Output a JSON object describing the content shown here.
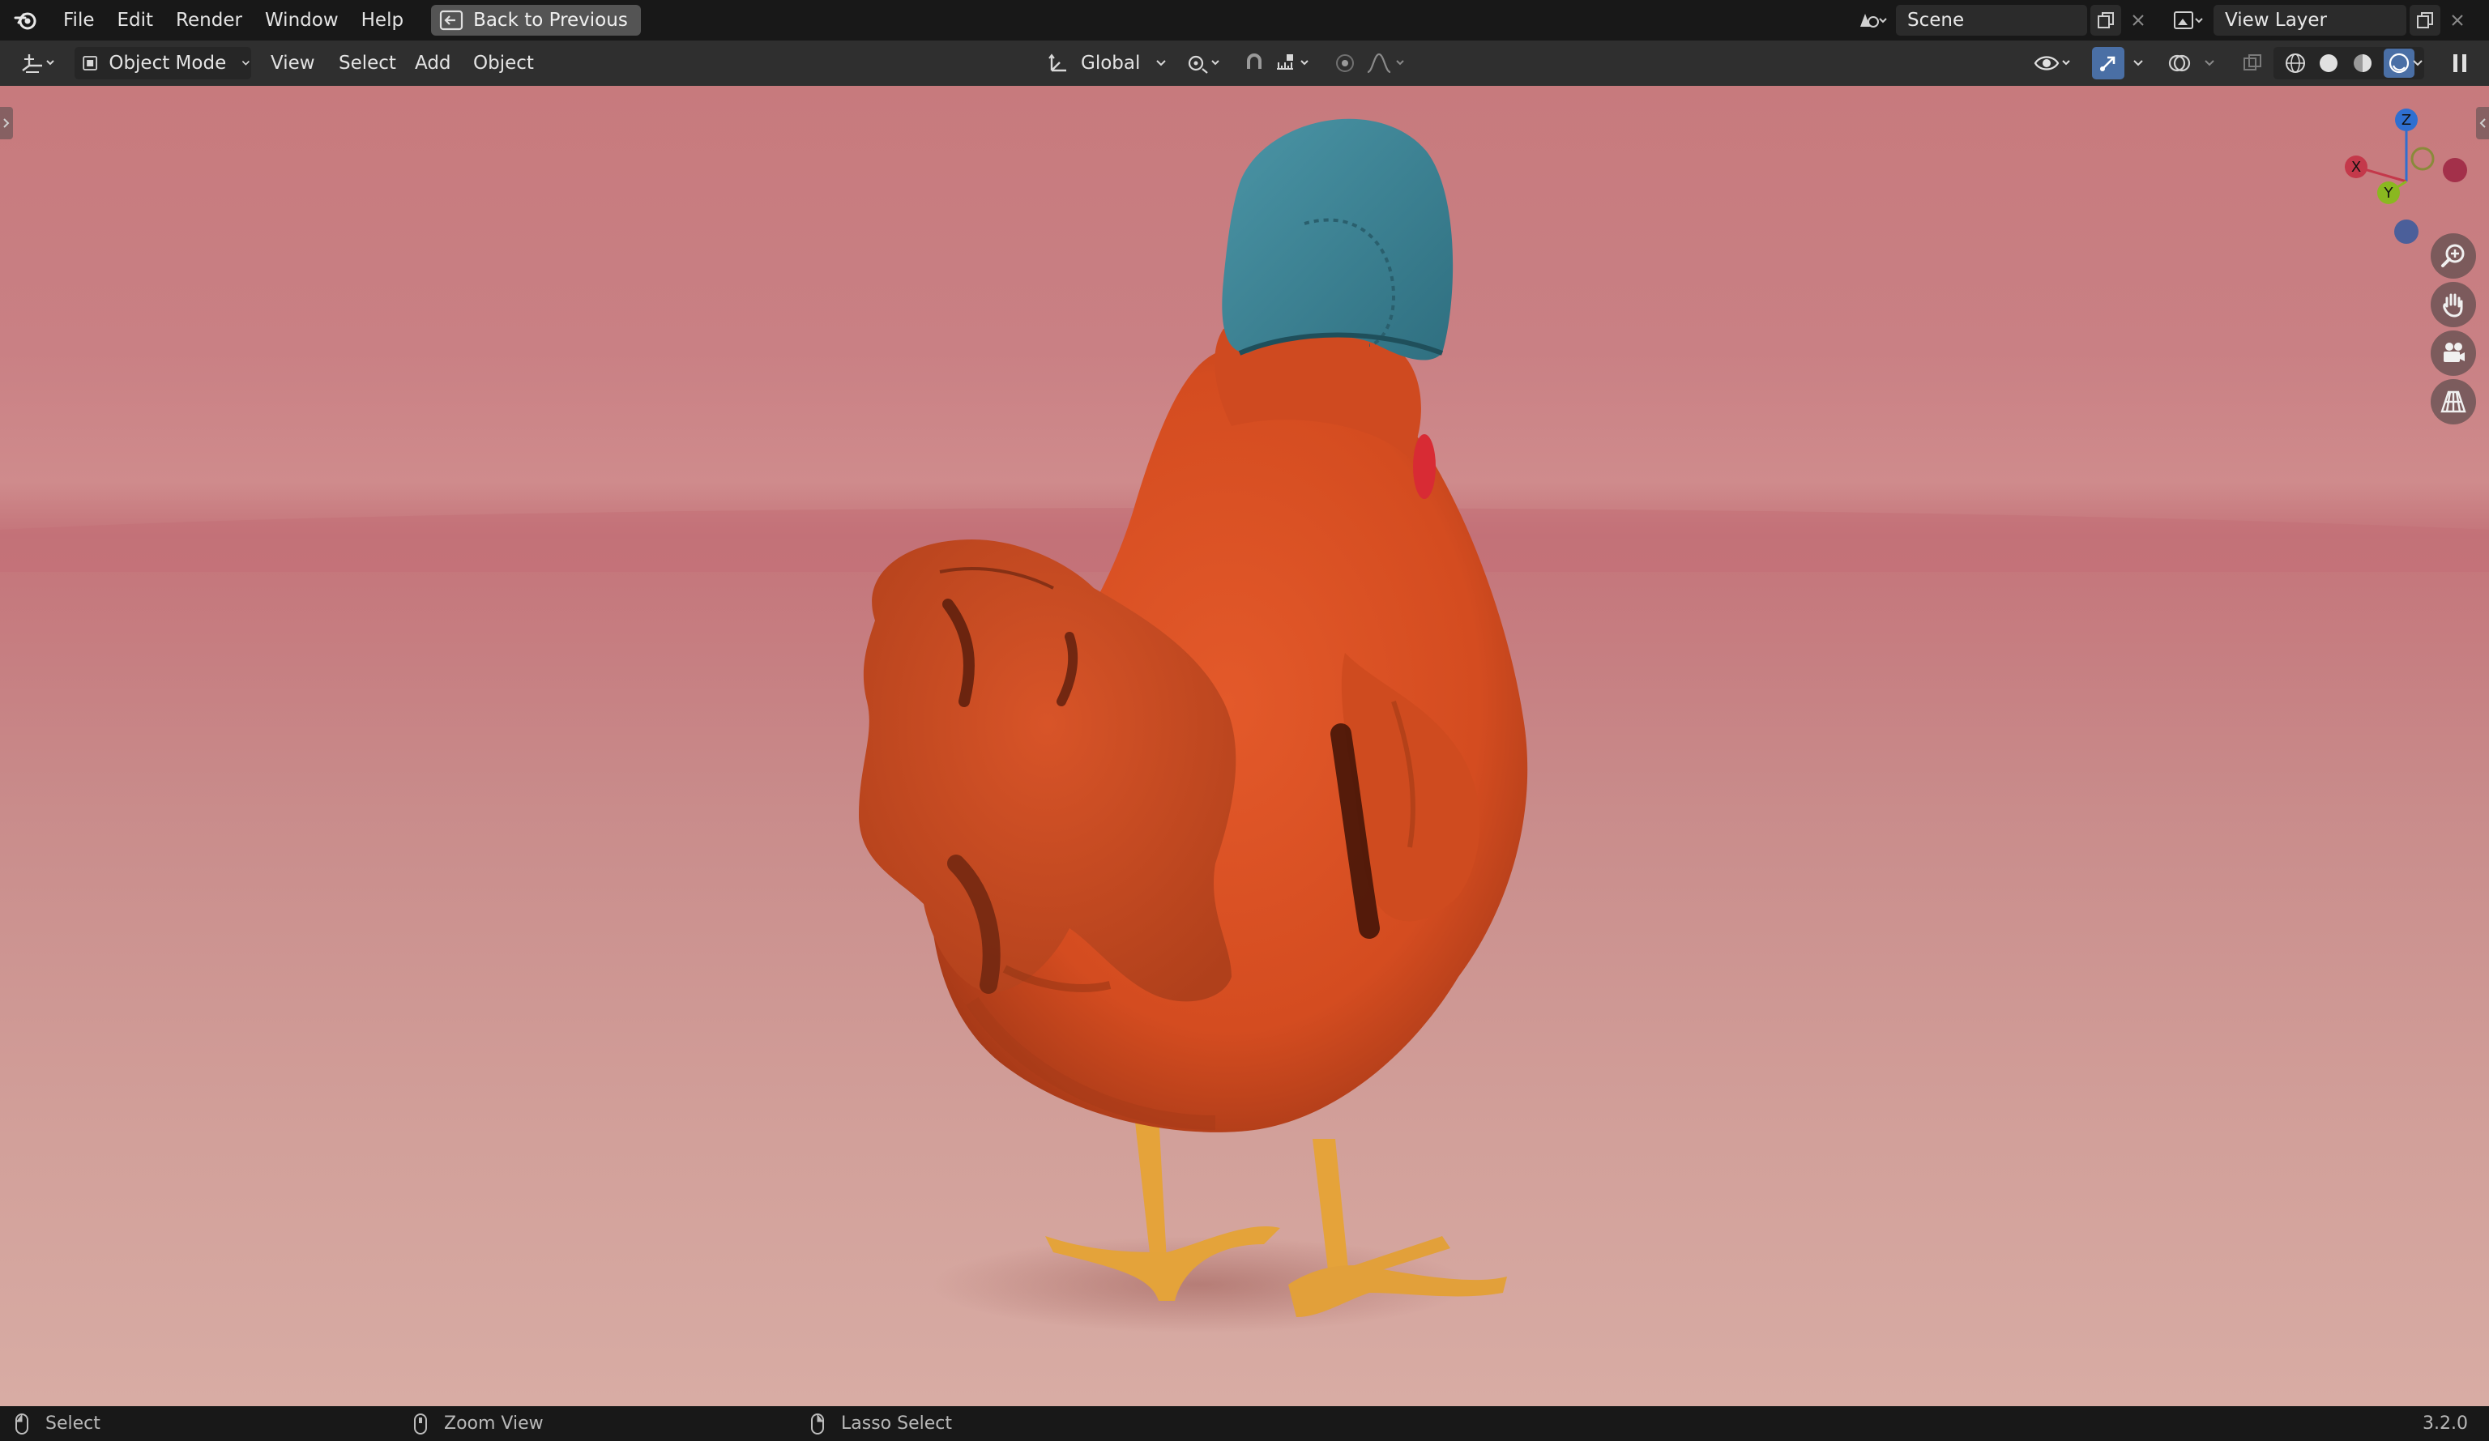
{
  "topbar": {
    "menus": [
      "File",
      "Edit",
      "Render",
      "Window",
      "Help"
    ],
    "back_button": "Back to Previous",
    "scene": "Scene",
    "view_layer": "View Layer"
  },
  "toolbar": {
    "mode": "Object Mode",
    "menus": [
      "View",
      "Select",
      "Add",
      "Object"
    ],
    "transform_orientation": "Global"
  },
  "gizmo": {
    "x_label": "X",
    "y_label": "Y",
    "z_label": "Z",
    "colors": {
      "x": "#c4384a",
      "y": "#8ab820",
      "z": "#2f6fd0"
    }
  },
  "statusbar": {
    "select": "Select",
    "zoom": "Zoom View",
    "lasso": "Lasso Select",
    "version": "3.2.0"
  },
  "icons": {
    "app": "blender-logo-icon",
    "back": "back-arrow-icon",
    "editor_type": "3d-viewport-icon",
    "mode": "object-mode-icon",
    "orientation": "orientation-icon",
    "pivot": "pivot-point-icon",
    "snap": "magnet-icon",
    "proportional": "proportional-edit-icon",
    "visibility": "eye-icon",
    "gizmo_toggle": "gizmo-icon",
    "overlay": "overlay-icon",
    "xray": "xray-icon",
    "shading": [
      "wireframe-shading-icon",
      "solid-shading-icon",
      "material-shading-icon",
      "rendered-shading-icon"
    ],
    "nav": [
      "zoom-icon",
      "hand-pan-icon",
      "camera-icon",
      "grid-perspective-icon"
    ]
  }
}
